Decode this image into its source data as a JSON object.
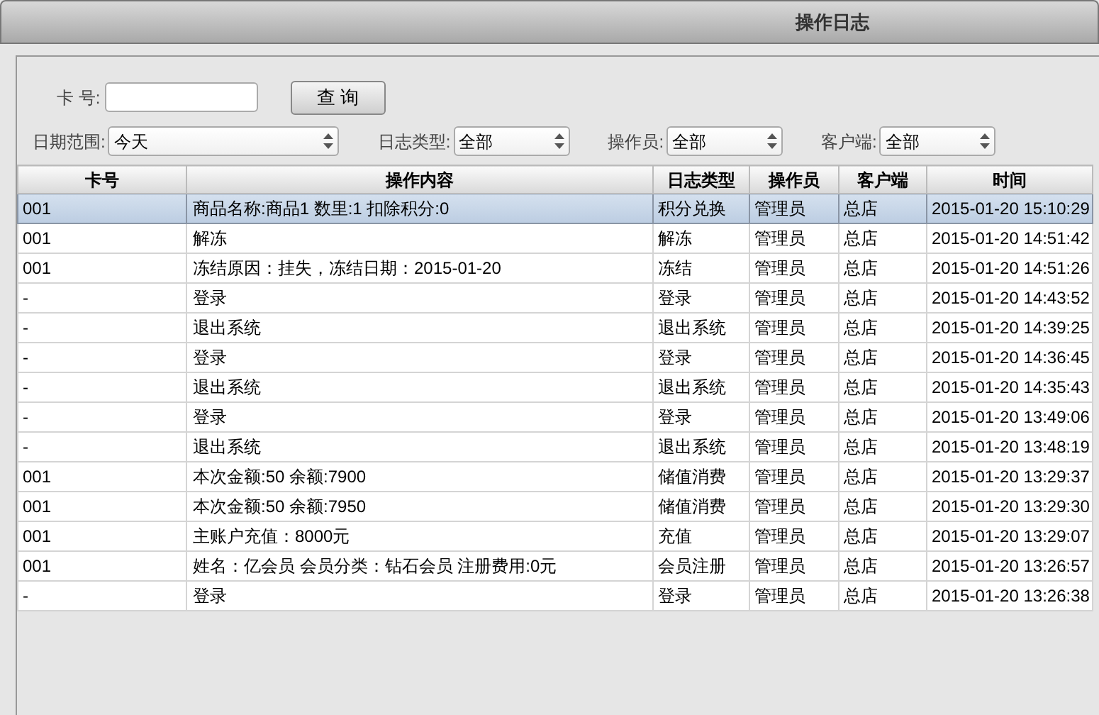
{
  "window": {
    "title": "操作日志"
  },
  "filters": {
    "card_label": "卡 号:",
    "search_button": "查 询",
    "selects": [
      {
        "label": "日期范围:",
        "value": "今天"
      },
      {
        "label": "日志类型:",
        "value": "全部"
      },
      {
        "label": "操作员:",
        "value": "全部"
      },
      {
        "label": "客户端:",
        "value": "全部"
      }
    ]
  },
  "table": {
    "columns": [
      "卡号",
      "操作内容",
      "日志类型",
      "操作员",
      "客户端",
      "时间"
    ],
    "rows": [
      {
        "selected": true,
        "cells": [
          "001",
          "商品名称:商品1 数里:1 扣除积分:0",
          "积分兑换",
          "管理员",
          "总店",
          "2015-01-20 15:10:29"
        ]
      },
      {
        "selected": false,
        "cells": [
          "001",
          "解冻",
          "解冻",
          "管理员",
          "总店",
          "2015-01-20 14:51:42"
        ]
      },
      {
        "selected": false,
        "cells": [
          "001",
          "冻结原因：挂失，冻结日期：2015-01-20",
          "冻结",
          "管理员",
          "总店",
          "2015-01-20 14:51:26"
        ]
      },
      {
        "selected": false,
        "cells": [
          "-",
          "登录",
          "登录",
          "管理员",
          "总店",
          "2015-01-20 14:43:52"
        ]
      },
      {
        "selected": false,
        "cells": [
          "-",
          "退出系统",
          "退出系统",
          "管理员",
          "总店",
          "2015-01-20 14:39:25"
        ]
      },
      {
        "selected": false,
        "cells": [
          "-",
          "登录",
          "登录",
          "管理员",
          "总店",
          "2015-01-20 14:36:45"
        ]
      },
      {
        "selected": false,
        "cells": [
          "-",
          "退出系统",
          "退出系统",
          "管理员",
          "总店",
          "2015-01-20 14:35:43"
        ]
      },
      {
        "selected": false,
        "cells": [
          "-",
          "登录",
          "登录",
          "管理员",
          "总店",
          "2015-01-20 13:49:06"
        ]
      },
      {
        "selected": false,
        "cells": [
          "-",
          "退出系统",
          "退出系统",
          "管理员",
          "总店",
          "2015-01-20 13:48:19"
        ]
      },
      {
        "selected": false,
        "cells": [
          "001",
          "本次金额:50 余额:7900",
          "储值消费",
          "管理员",
          "总店",
          "2015-01-20 13:29:37"
        ]
      },
      {
        "selected": false,
        "cells": [
          "001",
          "本次金额:50 余额:7950",
          "储值消费",
          "管理员",
          "总店",
          "2015-01-20 13:29:30"
        ]
      },
      {
        "selected": false,
        "cells": [
          "001",
          "主账户充值：8000元",
          "充值",
          "管理员",
          "总店",
          "2015-01-20 13:29:07"
        ]
      },
      {
        "selected": false,
        "cells": [
          "001",
          "姓名：亿会员 会员分类：钻石会员  注册费用:0元",
          "会员注册",
          "管理员",
          "总店",
          "2015-01-20 13:26:57"
        ]
      },
      {
        "selected": false,
        "cells": [
          "-",
          "登录",
          "登录",
          "管理员",
          "总店",
          "2015-01-20 13:26:38"
        ]
      }
    ]
  }
}
